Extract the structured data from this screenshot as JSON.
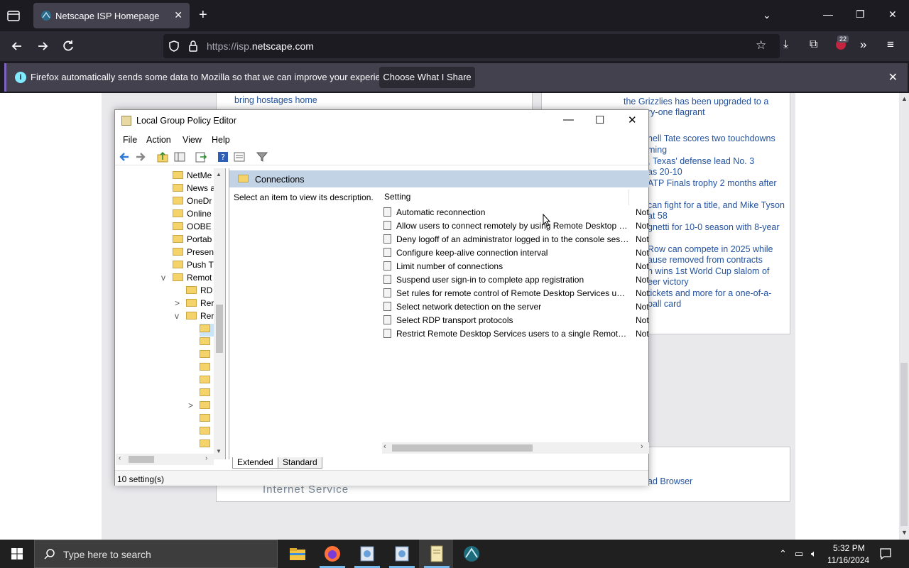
{
  "browser": {
    "tab_title": "Netscape ISP Homepage",
    "url_prefix": "https://isp.",
    "url_domain": "netscape.com",
    "extension_badge": "22",
    "notice_text": "Firefox automatically sends some data to Mozilla so that we can improve your experience.",
    "notice_button": "Choose What I Share"
  },
  "webpage": {
    "left_news": [
      "bring hostages home"
    ],
    "right_news": [
      "the Grizzlies has been upgraded to a",
      "ry-one flagrant",
      "nell Tate scores two touchdowns",
      "ming",
      ", Texas' defense lead No. 3",
      "as 20-10",
      "ATP Finals trophy 2 months after",
      "can fight for a title, and Mike Tyson",
      "at 58",
      "gnetti for 10-0 season with 8-year",
      "Row can compete in 2025 while",
      "ause removed from contracts",
      "n wins 1st World Cup slalom of",
      "eer victory",
      " tickets and more for a one-of-a-",
      "ball card"
    ],
    "bottom_right_link": "ad Browser",
    "footer_text": "Internet Service"
  },
  "gpedit": {
    "title": "Local Group Policy Editor",
    "menu": [
      "File",
      "Action",
      "View",
      "Help"
    ],
    "tree_items": [
      {
        "label": "NetMe",
        "level": 1,
        "expander": ""
      },
      {
        "label": "News a",
        "level": 1,
        "expander": ""
      },
      {
        "label": "OneDr",
        "level": 1,
        "expander": ""
      },
      {
        "label": "Online",
        "level": 1,
        "expander": ""
      },
      {
        "label": "OOBE",
        "level": 1,
        "expander": ""
      },
      {
        "label": "Portab",
        "level": 1,
        "expander": ""
      },
      {
        "label": "Presen",
        "level": 1,
        "expander": ""
      },
      {
        "label": "Push T",
        "level": 1,
        "expander": ""
      },
      {
        "label": "Remot",
        "level": 1,
        "expander": "v"
      },
      {
        "label": "RD",
        "level": 2,
        "expander": ""
      },
      {
        "label": "Rer",
        "level": 2,
        "expander": ">"
      },
      {
        "label": "Rer",
        "level": 2,
        "expander": "v"
      },
      {
        "label": "",
        "level": 3,
        "expander": ""
      },
      {
        "label": "",
        "level": 3,
        "expander": ""
      },
      {
        "label": "",
        "level": 3,
        "expander": ""
      },
      {
        "label": "",
        "level": 3,
        "expander": ""
      },
      {
        "label": "",
        "level": 3,
        "expander": ""
      },
      {
        "label": "",
        "level": 3,
        "expander": ""
      },
      {
        "label": "",
        "level": 3,
        "expander": ">"
      },
      {
        "label": "",
        "level": 3,
        "expander": ""
      },
      {
        "label": "",
        "level": 3,
        "expander": ""
      },
      {
        "label": "",
        "level": 3,
        "expander": ""
      }
    ],
    "section_title": "Connections",
    "description": "Select an item to view its description.",
    "column_setting": "Setting",
    "settings": [
      {
        "name": "Automatic reconnection",
        "state": "Not"
      },
      {
        "name": "Allow users to connect remotely by using Remote Desktop Services",
        "state": "Not"
      },
      {
        "name": "Deny logoff of an administrator logged in to the console session",
        "state": "Not"
      },
      {
        "name": "Configure keep-alive connection interval",
        "state": "Not"
      },
      {
        "name": "Limit number of connections",
        "state": "Not"
      },
      {
        "name": "Suspend user sign-in to complete app registration",
        "state": "Not"
      },
      {
        "name": "Set rules for remote control of Remote Desktop Services user sessions",
        "state": "Not"
      },
      {
        "name": "Select network detection on the server",
        "state": "Not"
      },
      {
        "name": "Select RDP transport protocols",
        "state": "Not"
      },
      {
        "name": "Restrict Remote Desktop Services users to a single Remote Desktop Services session",
        "state": "Not"
      }
    ],
    "tab_extended": "Extended",
    "tab_standard": "Standard",
    "status": "10 setting(s)"
  },
  "taskbar": {
    "search_placeholder": "Type here to search",
    "time": "5:32 PM",
    "date": "11/16/2024"
  }
}
